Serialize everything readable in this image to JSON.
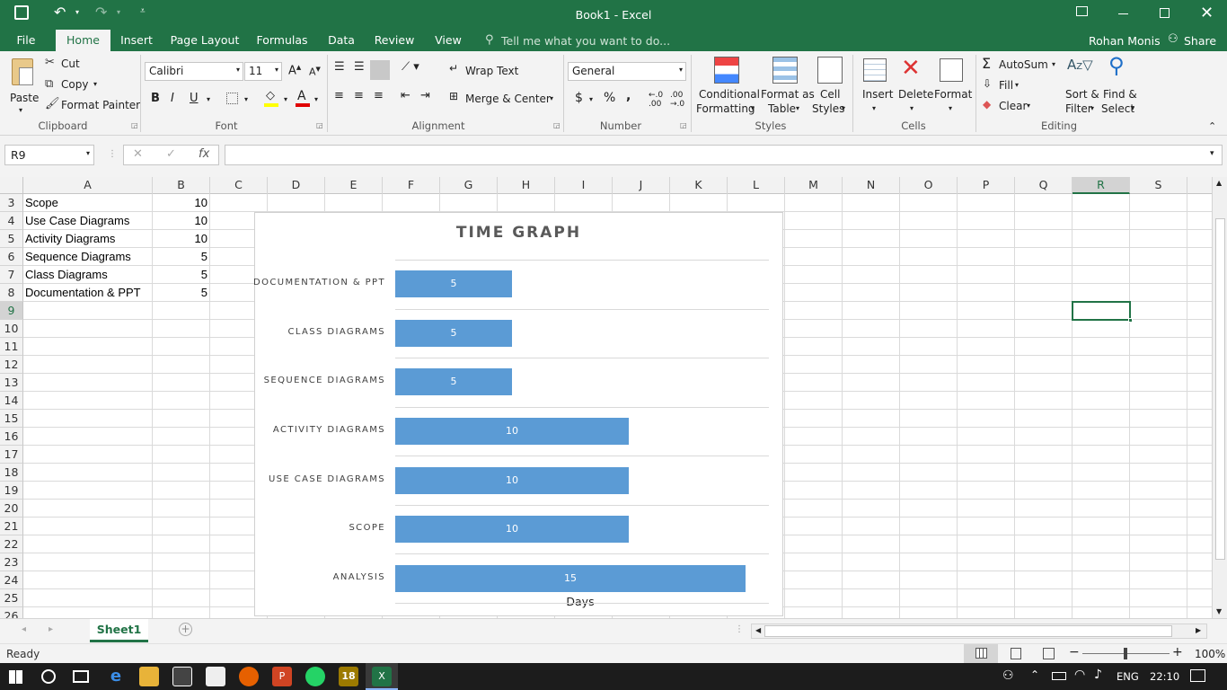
{
  "window": {
    "title": "Book1 - Excel",
    "user": "Rohan Monis",
    "share_label": "Share"
  },
  "menu": {
    "tabs": [
      "File",
      "Home",
      "Insert",
      "Page Layout",
      "Formulas",
      "Data",
      "Review",
      "View"
    ],
    "tell_me": "Tell me what you want to do..."
  },
  "ribbon": {
    "clipboard": {
      "paste": "Paste",
      "cut": "Cut",
      "copy": "Copy",
      "format_painter": "Format Painter",
      "label": "Clipboard"
    },
    "font": {
      "name": "Calibri",
      "size": "11",
      "label": "Font",
      "bold": "B",
      "italic": "I",
      "underline": "U"
    },
    "alignment": {
      "wrap_text": "Wrap Text",
      "merge_center": "Merge & Center",
      "label": "Alignment"
    },
    "number": {
      "format": "General",
      "label": "Number",
      "currency": "$",
      "percent": "%",
      "comma": ","
    },
    "styles": {
      "conditional": [
        "Conditional",
        "Formatting"
      ],
      "format_table": [
        "Format as",
        "Table"
      ],
      "cell_styles": [
        "Cell",
        "Styles"
      ],
      "label": "Styles"
    },
    "cells": {
      "insert": "Insert",
      "delete": "Delete",
      "format": "Format",
      "label": "Cells"
    },
    "editing": {
      "autosum": "AutoSum",
      "fill": "Fill",
      "clear": "Clear",
      "sort": [
        "Sort &",
        "Filter"
      ],
      "find": [
        "Find &",
        "Select"
      ],
      "label": "Editing"
    }
  },
  "formula_bar": {
    "name_box": "R9",
    "formula": ""
  },
  "columns": [
    "A",
    "B",
    "C",
    "D",
    "E",
    "F",
    "G",
    "H",
    "I",
    "J",
    "K",
    "L",
    "M",
    "N",
    "O",
    "P",
    "Q",
    "R",
    "S"
  ],
  "rows": [
    "3",
    "4",
    "5",
    "6",
    "7",
    "8",
    "9",
    "10",
    "11",
    "12",
    "13",
    "14",
    "15",
    "16",
    "17",
    "18",
    "19",
    "20",
    "21",
    "22",
    "23",
    "24",
    "25",
    "26"
  ],
  "cells": [
    {
      "a": "Scope",
      "b": "10"
    },
    {
      "a": "Use Case Diagrams",
      "b": "10"
    },
    {
      "a": "Activity Diagrams",
      "b": "10"
    },
    {
      "a": "Sequence Diagrams",
      "b": "5"
    },
    {
      "a": "Class Diagrams",
      "b": "5"
    },
    {
      "a": "Documentation & PPT",
      "b": "5"
    }
  ],
  "selected_cell": "R9",
  "chart_data": {
    "type": "bar",
    "orientation": "horizontal",
    "title": "TIME GRAPH",
    "xlabel": "Days",
    "ylabel": "",
    "categories": [
      "DOCUMENTATION & PPT",
      "CLASS DIAGRAMS",
      "SEQUENCE DIAGRAMS",
      "ACTIVITY DIAGRAMS",
      "USE CASE DIAGRAMS",
      "SCOPE",
      "ANALYSIS"
    ],
    "values": [
      5,
      5,
      5,
      10,
      10,
      10,
      15
    ],
    "xlim": [
      0,
      16
    ],
    "bar_color": "#5b9bd5",
    "data_labels": true,
    "grid": true
  },
  "sheets": {
    "tabs": [
      "Sheet1"
    ],
    "active": "Sheet1"
  },
  "status": {
    "text": "Ready",
    "zoom": "100%"
  },
  "taskbar": {
    "lang": "ENG",
    "time": "22:10",
    "badge": "18"
  },
  "colors": {
    "accent": "#217346",
    "bar": "#5b9bd5"
  }
}
